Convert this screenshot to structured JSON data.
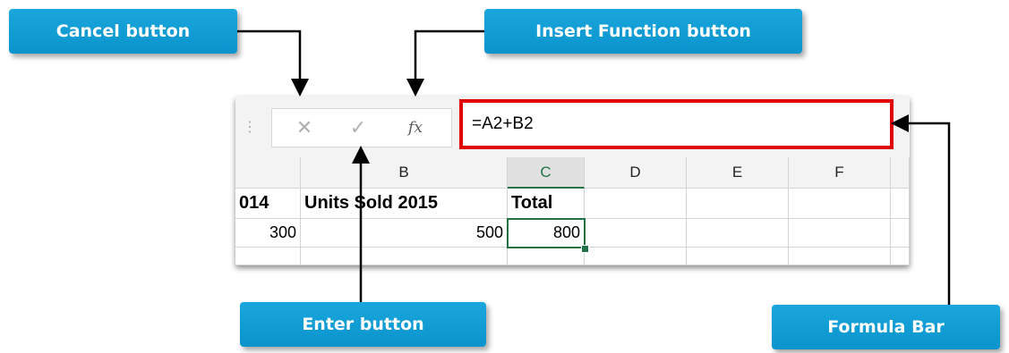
{
  "callouts": {
    "cancel": "Cancel button",
    "insert_function": "Insert Function button",
    "enter": "Enter button",
    "formula_bar": "Formula Bar"
  },
  "formula_bar": {
    "cancel_icon": "✕",
    "enter_icon": "✓",
    "insert_function_icon": "fx",
    "formula": "=A2+B2"
  },
  "grid": {
    "columns": [
      "",
      "B",
      "C",
      "D",
      "E",
      "F",
      ""
    ],
    "active_column": "C",
    "row1": {
      "a": "014",
      "b": "Units Sold 2015",
      "c": "Total"
    },
    "row2": {
      "a": "300",
      "b": "500",
      "c": "800"
    }
  },
  "colors": {
    "callout": "#0a93cc",
    "highlight": "#e00000",
    "excel_green": "#217346"
  }
}
